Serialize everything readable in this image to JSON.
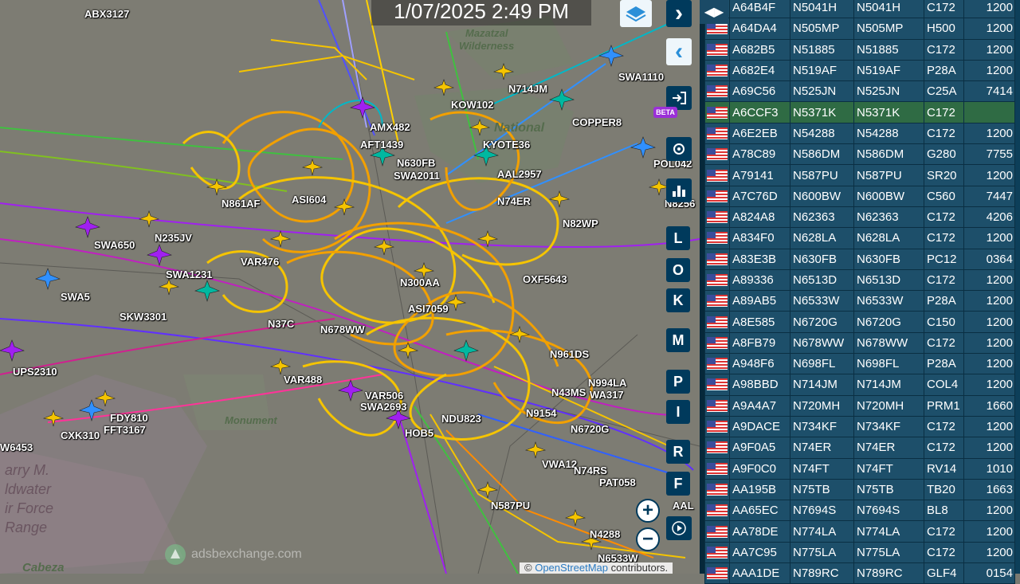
{
  "clock": "1/07/2025 2:49 PM",
  "map": {
    "watermark": "adsbexchange.com",
    "attribution_prefix": "©",
    "attribution_link": "OpenStreetMap",
    "attribution_suffix": "contributors.",
    "place_labels": {
      "mazatzal": "Mazatzal",
      "wilderness": "Wilderness",
      "national": "National",
      "monument": "Monument",
      "goldwater_1": "arry M.",
      "goldwater_2": "ldwater",
      "goldwater_3": "ir Force",
      "goldwater_4": "Range",
      "cabeza": "Cabeza"
    },
    "aircraft_labels": [
      "ABX3127",
      "SWA1110",
      "N714JM",
      "KOW102",
      "COPPER8",
      "AMX482",
      "AFT1439",
      "N630FB",
      "SWA2011",
      "KYOTE36",
      "AAL2957",
      "N861AF",
      "ASI604",
      "N74ER",
      "N82WP",
      "SWA650",
      "N235JV",
      "VAR476",
      "SWA1231",
      "SWA5",
      "SKW3301",
      "N37C",
      "N678WW",
      "N300AA",
      "ASI7059",
      "OXF5643",
      "UPS2310",
      "VAR488",
      "VAR506",
      "SWA2693",
      "FDY810",
      "FFT3167",
      "CXK310",
      "W6453",
      "HOB5",
      "NDU823",
      "N6720G",
      "N961DS",
      "N994LA",
      "WA317",
      "N9154",
      "N43MS",
      "VWA12",
      "N74RS",
      "PAT058",
      "N587PU",
      "N4288",
      "N6533W",
      "AAL",
      "POL042",
      "N8256"
    ],
    "controls": {
      "layers_icon": "layers-icon",
      "next_label": "›",
      "prev_label": "‹",
      "login_icon": "login-icon",
      "beta_badge": "BETA",
      "settings_icon": "gear-icon",
      "stats_icon": "chart-icon",
      "keys": [
        "L",
        "O",
        "K",
        "M",
        "P",
        "I",
        "R",
        "F"
      ],
      "zoom_in": "+",
      "zoom_out": "−",
      "replay_icon": "play-icon"
    }
  },
  "table": {
    "toggle_label": "◀▶",
    "rows": [
      [
        "A64B4F",
        "N5041H",
        "N5041H",
        "C172",
        "1200"
      ],
      [
        "A64DA4",
        "N505MP",
        "N505MP",
        "H500",
        "1200"
      ],
      [
        "A682B5",
        "N51885",
        "N51885",
        "C172",
        "1200"
      ],
      [
        "A682E4",
        "N519AF",
        "N519AF",
        "P28A",
        "1200"
      ],
      [
        "A69C56",
        "N525JN",
        "N525JN",
        "C25A",
        "7414"
      ],
      [
        "A6CCF3",
        "N5371K",
        "N5371K",
        "C172",
        ""
      ],
      [
        "A6E2EB",
        "N54288",
        "N54288",
        "C172",
        "1200"
      ],
      [
        "A78C89",
        "N586DM",
        "N586DM",
        "G280",
        "7755"
      ],
      [
        "A79141",
        "N587PU",
        "N587PU",
        "SR20",
        "1200"
      ],
      [
        "A7C76D",
        "N600BW",
        "N600BW",
        "C560",
        "7447"
      ],
      [
        "A824A8",
        "N62363",
        "N62363",
        "C172",
        "4206"
      ],
      [
        "A834F0",
        "N628LA",
        "N628LA",
        "C172",
        "1200"
      ],
      [
        "A83E3B",
        "N630FB",
        "N630FB",
        "PC12",
        "0364"
      ],
      [
        "A89336",
        "N6513D",
        "N6513D",
        "C172",
        "1200"
      ],
      [
        "A89AB5",
        "N6533W",
        "N6533W",
        "P28A",
        "1200"
      ],
      [
        "A8E585",
        "N6720G",
        "N6720G",
        "C150",
        "1200"
      ],
      [
        "A8FB79",
        "N678WW",
        "N678WW",
        "C172",
        "1200"
      ],
      [
        "A948F6",
        "N698FL",
        "N698FL",
        "P28A",
        "1200"
      ],
      [
        "A98BBD",
        "N714JM",
        "N714JM",
        "COL4",
        "1200"
      ],
      [
        "A9A4A7",
        "N720MH",
        "N720MH",
        "PRM1",
        "1660"
      ],
      [
        "A9DACE",
        "N734KF",
        "N734KF",
        "C172",
        "1200"
      ],
      [
        "A9F0A5",
        "N74ER",
        "N74ER",
        "C172",
        "1200"
      ],
      [
        "A9F0C0",
        "N74FT",
        "N74FT",
        "RV14",
        "1010"
      ],
      [
        "AA195B",
        "N75TB",
        "N75TB",
        "TB20",
        "1663"
      ],
      [
        "AA65EC",
        "N7694S",
        "N7694S",
        "BL8",
        "1200"
      ],
      [
        "AA78DE",
        "N774LA",
        "N774LA",
        "C172",
        "1200"
      ],
      [
        "AA7C95",
        "N775LA",
        "N775LA",
        "C172",
        "1200"
      ],
      [
        "AAA1DE",
        "N789RC",
        "N789RC",
        "GLF4",
        "0154"
      ]
    ],
    "selected_index": 5
  },
  "colors": {
    "sidebar_bg": "#0d3f59",
    "row_bg": "#1d4f6a",
    "selected_row": "#2f6b44",
    "track_yellow": "#f5c400",
    "track_orange": "#f2a000",
    "track_purple": "#a020f0",
    "track_blue": "#3060ff",
    "track_cyan": "#00b8c8"
  }
}
